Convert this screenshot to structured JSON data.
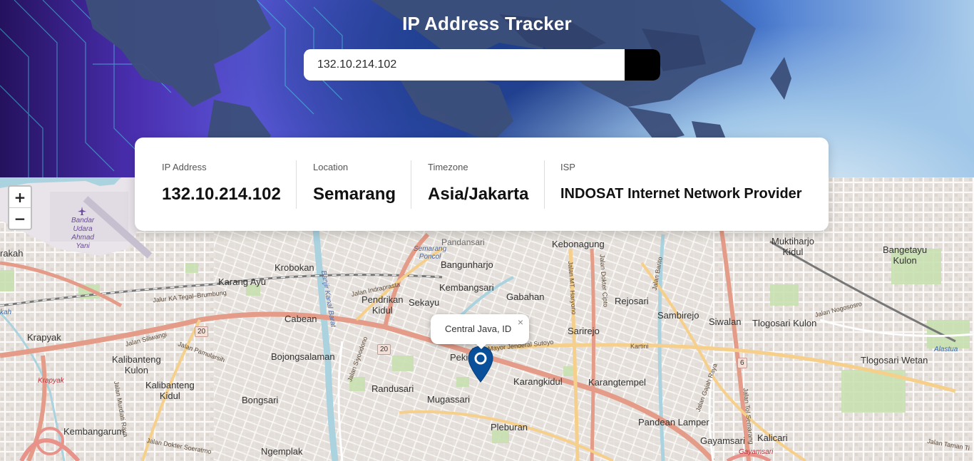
{
  "header": {
    "title": "IP Address Tracker"
  },
  "search": {
    "value": "132.10.214.102",
    "button_icon": "chevron-right-icon"
  },
  "info": {
    "ip_label": "IP Address",
    "ip_value": "132.10.214.102",
    "location_label": "Location",
    "location_value": "Semarang",
    "timezone_label": "Timezone",
    "timezone_value": "Asia/Jakarta",
    "isp_label": "ISP",
    "isp_value": "INDOSAT Internet Network Provider"
  },
  "map": {
    "zoom_in": "+",
    "zoom_out": "−",
    "popup_text": "Central Java, ID",
    "popup_close": "×",
    "labels": {
      "airport": "Bandar\nUdara\nAhmad\nYani",
      "pandansari": "Pandansari",
      "kebonagung": "Kebonagung",
      "muktiharjo": "Muktiharjo\nKidul",
      "bangetayu": "Bangetayu\nKulon",
      "krobokan": "Krobokan",
      "semarang_poncol": "Semarang\nPoncol",
      "bangunharjo": "Bangunharjo",
      "karang_ayu": "Karang Ayu",
      "kembangsari": "Kembangsari",
      "pendrikan": "Pendrikan\nKidul",
      "sekayu": "Sekayu",
      "gabahan": "Gabahan",
      "rejosari": "Rejosari",
      "sambirejo": "Sambirejo",
      "krapyak": "Krapyak",
      "cabean": "Cabean",
      "sarirejo": "Sarirejo",
      "siwalan": "Siwalan",
      "tlogosari_kulon": "Tlogosari Kulon",
      "kalibanteng_kulon": "Kalibanteng\nKulon",
      "bojongsalaman": "Bojongsalaman",
      "kalibanteng_kidul": "Kalibanteng\nKidul",
      "randusari": "Randusari",
      "karangkidul": "Karangkidul",
      "karangtempel": "Karangtempel",
      "tlogosari_wetan": "Tlogosari Wetan",
      "bongsari": "Bongsari",
      "mugassari": "Mugassari",
      "kembangarum": "Kembangarum",
      "pleburan": "Pleburan",
      "pandean_lamper": "Pandean Lamper",
      "ngemplak": "Ngemplak",
      "gayamsari": "Gayamsari",
      "kalicari": "Kalicari",
      "pekunden": "Peki",
      "jalan_siliwangi": "Jalan Siliwangi",
      "jalan_pamularsih": "Jalan Pamularsih",
      "jalan_sutoyo": "Jalan Mayor Jenderal Sutoyo",
      "jalan_indraprasta": "Jalan Indraprasta",
      "jalan_mt_haryono": "Jalan MT. Haryono",
      "jalan_dokter_cipto": "Jalan Dokter Cipto",
      "jalan_barito": "Jalan Barito",
      "jalan_nogososro": "Jalan Nogososro",
      "jalan_kartini": "Kartini",
      "jalan_gajah_raya": "Jalan Gajah Raya",
      "jalan_tol": "Jalan Tol Semarang",
      "jalan_murdiati": "Jalan Murdiati Raya",
      "jalan_soeratmo": "Jalan Dokter Soeratmo",
      "jalan_taman": "Jalan Taman Ti",
      "jalan_syuhada": "Jalan Siyoodono",
      "jalur_ka": "Jalur KA Tegal–Brumbung",
      "alastua": "Alastua",
      "krapyak_red": "Krapyak",
      "gayamsari_it": "Gayamsari",
      "banjir_kanal": "Banjir Kanal Barat",
      "rakah": "rakah",
      "kah": "kah",
      "road_20a": "20",
      "road_20b": "20",
      "road_6": "6"
    }
  }
}
